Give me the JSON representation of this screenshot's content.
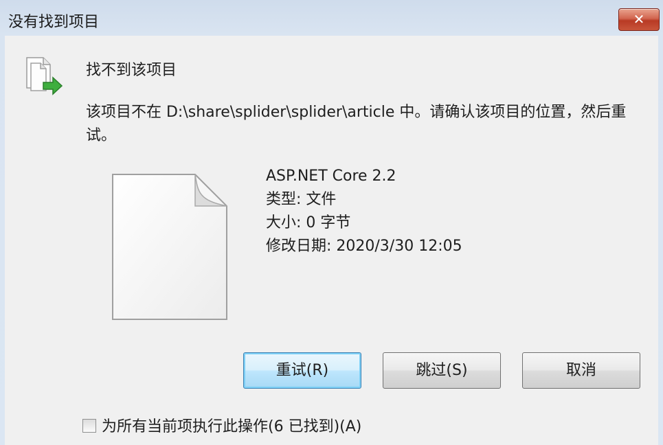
{
  "window": {
    "title": "没有找到项目",
    "close_label": "✕"
  },
  "dialog": {
    "heading": "找不到该项目",
    "message": "该项目不在 D:\\share\\splider\\splider\\article 中。请确认该项目的位置，然后重试。",
    "file": {
      "name": "ASP.NET Core 2.2",
      "type": "类型: 文件",
      "size": "大小: 0 字节",
      "modified": "修改日期: 2020/3/30 12:05"
    }
  },
  "buttons": {
    "retry": "重试(R)",
    "skip": "跳过(S)",
    "cancel": "取消"
  },
  "checkbox": {
    "label": "为所有当前项执行此操作(6 已找到)(A)",
    "checked": false
  },
  "icons": {
    "small_file": "file-move-icon",
    "large_file": "blank-document-icon",
    "close": "close-icon"
  }
}
